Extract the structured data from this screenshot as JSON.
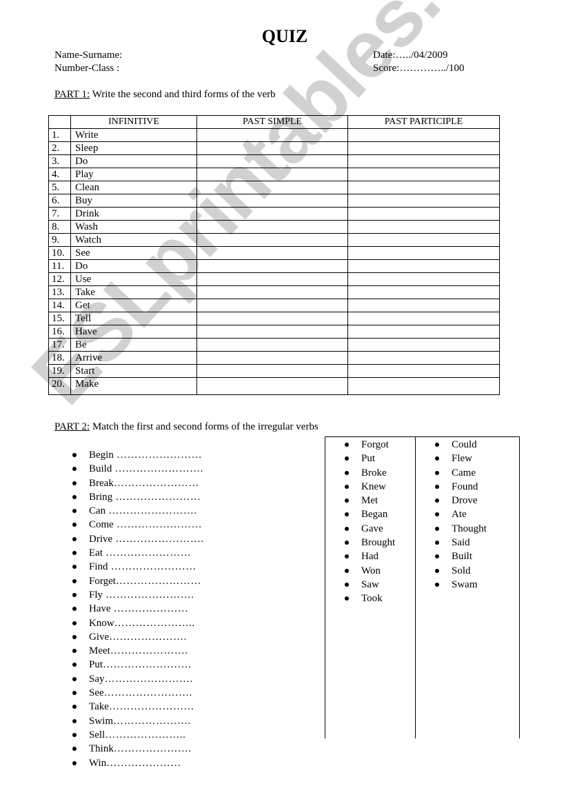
{
  "watermark": "ESLprintables.com",
  "header": {
    "title": "QUIZ",
    "name_label": "Name-Surname:",
    "number_label": "Number-Class  :",
    "date_label": "Date:…../04/2009",
    "score_label": "Score:…………../100"
  },
  "part1": {
    "label": "PART 1:",
    "instruction": " Write the second and third forms of the verb",
    "columns": [
      "",
      "INFINITIVE",
      "PAST SIMPLE",
      "PAST PARTICIPLE"
    ],
    "rows": [
      {
        "num": "1.",
        "verb": "Write",
        "past_simple": "",
        "past_participle": ""
      },
      {
        "num": "2.",
        "verb": "Sleep",
        "past_simple": "",
        "past_participle": ""
      },
      {
        "num": "3.",
        "verb": "Do",
        "past_simple": "",
        "past_participle": ""
      },
      {
        "num": "4.",
        "verb": "Play",
        "past_simple": "",
        "past_participle": ""
      },
      {
        "num": "5.",
        "verb": "Clean",
        "past_simple": "",
        "past_participle": ""
      },
      {
        "num": "6.",
        "verb": "Buy",
        "past_simple": "",
        "past_participle": ""
      },
      {
        "num": "7.",
        "verb": "Drink",
        "past_simple": "",
        "past_participle": ""
      },
      {
        "num": "8.",
        "verb": "Wash",
        "past_simple": "",
        "past_participle": ""
      },
      {
        "num": "9.",
        "verb": "Watch",
        "past_simple": "",
        "past_participle": ""
      },
      {
        "num": "10.",
        "verb": "See",
        "past_simple": "",
        "past_participle": ""
      },
      {
        "num": "11.",
        "verb": "Do",
        "past_simple": "",
        "past_participle": ""
      },
      {
        "num": "12.",
        "verb": "Use",
        "past_simple": "",
        "past_participle": ""
      },
      {
        "num": "13.",
        "verb": "Take",
        "past_simple": "",
        "past_participle": ""
      },
      {
        "num": "14.",
        "verb": "Get",
        "past_simple": "",
        "past_participle": ""
      },
      {
        "num": "15.",
        "verb": "Tell",
        "past_simple": "",
        "past_participle": ""
      },
      {
        "num": "16.",
        "verb": "Have",
        "past_simple": "",
        "past_participle": ""
      },
      {
        "num": "17.",
        "verb": "Be",
        "past_simple": "",
        "past_participle": ""
      },
      {
        "num": "18.",
        "verb": "Arrive",
        "past_simple": "",
        "past_participle": ""
      },
      {
        "num": "19.",
        "verb": "Start",
        "past_simple": "",
        "past_participle": ""
      },
      {
        "num": "20.",
        "verb": "Make",
        "past_simple": "",
        "past_participle": ""
      }
    ]
  },
  "part2": {
    "label": "PART 2:",
    "instruction": " Match the first and second forms of the irregular verbs",
    "first_forms": [
      {
        "verb": "Begin",
        "blank": "  ……………………"
      },
      {
        "verb": "Build",
        "blank": "  ……………………."
      },
      {
        "verb": "Break",
        "blank": "……………………"
      },
      {
        "verb": "Bring",
        "blank": " ……………………"
      },
      {
        "verb": "Can",
        "blank": " ……………………."
      },
      {
        "verb": "Come",
        "blank": " ……………………"
      },
      {
        "verb": "Drive",
        "blank": " ……………………."
      },
      {
        "verb": "Eat",
        "blank": " ……………………"
      },
      {
        "verb": "Find",
        "blank": " ……………………"
      },
      {
        "verb": "Forget",
        "blank": "……………………"
      },
      {
        "verb": "Fly",
        "blank": " ……………………."
      },
      {
        "verb": "Have",
        "blank": " …………………"
      },
      {
        "verb": "Know",
        "blank": "………………….."
      },
      {
        "verb": "Give",
        "blank": "…………………."
      },
      {
        "verb": "Meet",
        "blank": "…………………."
      },
      {
        "verb": "Put",
        "blank": "……………………."
      },
      {
        "verb": "Say",
        "blank": "……………………."
      },
      {
        "verb": "See",
        "blank": "……………………."
      },
      {
        "verb": "Take",
        "blank": "……………………"
      },
      {
        "verb": "Swim",
        "blank": "…………………."
      },
      {
        "verb": "Sell",
        "blank": "………………….."
      },
      {
        "verb": "Think",
        "blank": "…………………."
      },
      {
        "verb": "Win",
        "blank": "…………………"
      }
    ],
    "second_forms_col1": [
      "Forgot",
      "Put",
      "Broke",
      "Knew",
      "Met",
      "Began",
      "Gave",
      "Brought",
      "Had",
      "Won",
      "Saw",
      "Took"
    ],
    "second_forms_col2": [
      "Could",
      "Flew",
      "Came",
      "Found",
      "Drove",
      "Ate",
      "Thought",
      "Said",
      "Built",
      "Sold",
      "Swam"
    ]
  }
}
